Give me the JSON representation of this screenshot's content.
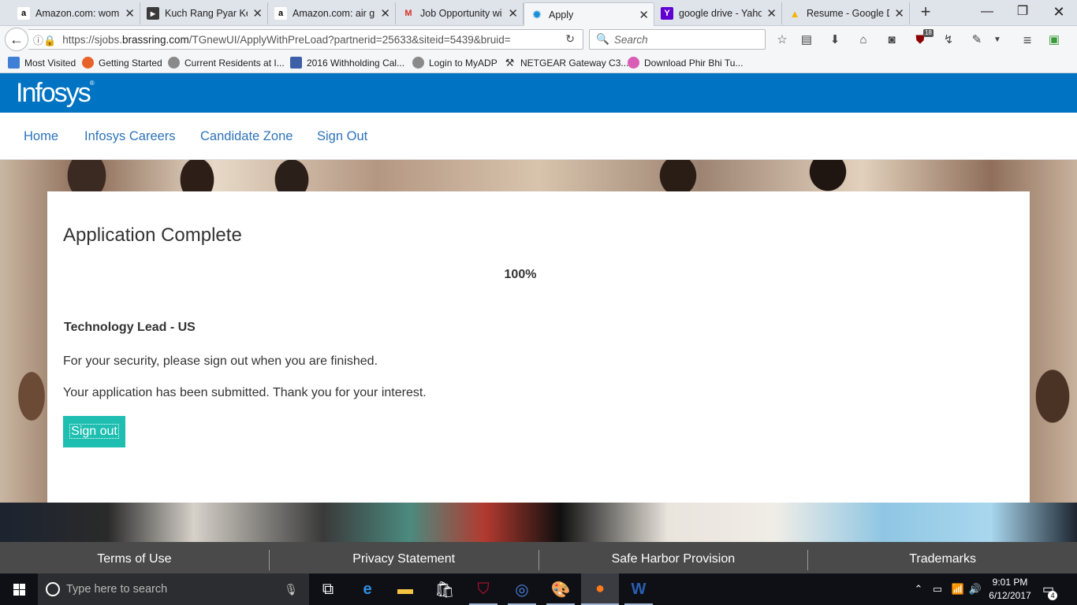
{
  "browser": {
    "tabs": [
      {
        "label": "Amazon.com: wom",
        "icon": "amazon-icon",
        "fav": "a"
      },
      {
        "label": "Kuch Rang Pyar Ke",
        "icon": "video-icon",
        "fav": "▶"
      },
      {
        "label": "Amazon.com: air g",
        "icon": "amazon-icon",
        "fav": "a"
      },
      {
        "label": "Job Opportunity wi",
        "icon": "gmail-icon",
        "fav": "M"
      },
      {
        "label": "Apply",
        "icon": "lightbulb-icon",
        "fav": "💡"
      },
      {
        "label": "google drive - Yaho",
        "icon": "yahoo-icon",
        "fav": "Y"
      },
      {
        "label": "Resume - Google D",
        "icon": "google-drive-icon",
        "fav": "▲"
      }
    ],
    "url_prefix": "https://sjobs.",
    "url_host": "brassring.com",
    "url_path": "/TGnewUI/ApplyWithPreLoad?partnerid=25633&siteid=5439&bruid=",
    "search_placeholder": "Search",
    "ublock_badge": "18",
    "bookmarks": [
      {
        "label": "Most Visited",
        "color": "#3f7fd6"
      },
      {
        "label": "Getting Started",
        "color": "#e8632a"
      },
      {
        "label": "Current Residents at I...",
        "color": "#8a8a8a"
      },
      {
        "label": "2016 Withholding Cal...",
        "color": "#3c5fa8"
      },
      {
        "label": "Login to MyADP",
        "color": "#8a8a8a"
      },
      {
        "label": "NETGEAR Gateway C3...",
        "color": "#333333"
      },
      {
        "label": "Download Phir Bhi Tu...",
        "color": "#d95db7"
      }
    ]
  },
  "site": {
    "logo": "Infosys",
    "logo_mark": "®",
    "nav": [
      "Home",
      "Infosys Careers",
      "Candidate Zone",
      "Sign Out"
    ]
  },
  "application": {
    "title": "Application Complete",
    "progress_text": "100%",
    "progress": 1.0,
    "job_title": "Technology Lead - US",
    "security_msg": "For your security, please sign out when you are finished.",
    "submitted_msg": "Your application has been submitted. Thank you for your interest.",
    "signout_label": "Sign out"
  },
  "footer": [
    "Terms of Use",
    "Privacy Statement",
    "Safe Harbor Provision",
    "Trademarks"
  ],
  "taskbar": {
    "search_placeholder": "Type here to search",
    "time": "9:01 PM",
    "date": "6/12/2017",
    "notification_count": "4"
  },
  "colors": {
    "header_blue": "#0073c2",
    "nav_link": "#2e73b8",
    "button_teal": "#1ebfb1",
    "footer_gray": "#4a4a4a"
  }
}
